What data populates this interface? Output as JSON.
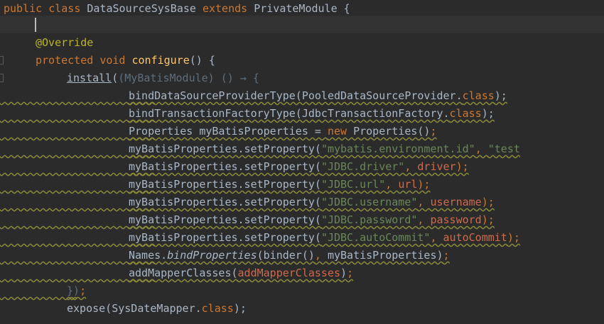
{
  "editor": {
    "lines": {
      "l1": {
        "t1": "public",
        "t2": " ",
        "t3": "class",
        "t4": " DataSourceSysBase ",
        "t5": "extends",
        "t6": " PrivateModule {"
      },
      "l2": {},
      "l3": {
        "t1": "@Override"
      },
      "l4": {
        "t1": "protected",
        "t2": " ",
        "t3": "void",
        "t4": " ",
        "t5": "configure",
        "t6": "() {"
      },
      "l5": {
        "t1": "install",
        "t2": "(",
        "t3": "(MyBatisModule) () → {"
      },
      "l6": {
        "t1": "bindDataSourceProviderType(PooledDataSourceProvider.",
        "t2": "class",
        "t3": ");"
      },
      "l7": {
        "t1": "bindTransactionFactoryType(JdbcTransactionFactory.",
        "t2": "class",
        "t3": ");"
      },
      "l8": {
        "t1": "Properties myBatisProperties = ",
        "t2": "new",
        "t3": " Properties()",
        "t4": ";"
      },
      "l9": {
        "t1": "myBatisProperties.setProperty(",
        "t2": "\"mybatis.environment.id\"",
        "t3": ", ",
        "t4": "\"test"
      },
      "l10": {
        "t1": "myBatisProperties.setProperty(",
        "t2": "\"JDBC.driver\"",
        "t3": ", ",
        "t4": "driver",
        "t5": ");"
      },
      "l11": {
        "t1": "myBatisProperties.setProperty(",
        "t2": "\"JDBC.url\"",
        "t3": ", ",
        "t4": "url",
        "t5": ");"
      },
      "l12": {
        "t1": "myBatisProperties.setProperty(",
        "t2": "\"JDBC.username\"",
        "t3": ", ",
        "t4": "username",
        "t5": ");"
      },
      "l13": {
        "t1": "myBatisProperties.setProperty(",
        "t2": "\"JDBC.password\"",
        "t3": ", ",
        "t4": "password",
        "t5": ");"
      },
      "l14": {
        "t1": "myBatisProperties.setProperty(",
        "t2": "\"JDBC.autoCommit\"",
        "t3": ", ",
        "t4": "autoCommit",
        "t5": ");"
      },
      "l15": {
        "t1": "Names.",
        "t2": "bindProperties",
        "t3": "(binder()",
        "t4": ", ",
        "t5": "myBatisProperties)",
        "t6": ";"
      },
      "l16": {
        "t1": "addMapperClasses(",
        "t2": "addMapperClasses",
        "t3": ")",
        "t4": ";"
      },
      "l17": {
        "t1": "})",
        "t2": ";"
      },
      "l18": {
        "t1": "expose(SysDateMapper.",
        "t2": "class",
        "t3": ");"
      }
    }
  }
}
